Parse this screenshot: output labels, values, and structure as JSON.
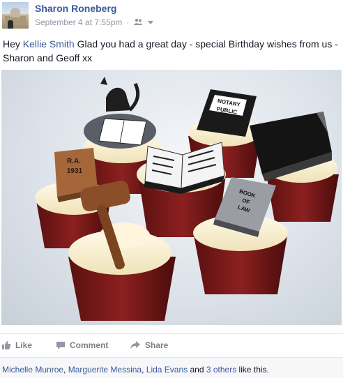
{
  "post": {
    "author": "Sharon Roneberg",
    "timestamp": "September 4 at 7:55pm",
    "separator": "·",
    "audience_icon": "friends-icon",
    "text_before": "Hey ",
    "mention": "Kellie Smith",
    "text_after": " Glad you had a great day - special Birthday wishes from us - Sharon and Geoff xx"
  },
  "photo": {
    "description_icon": "cupcakes-photo",
    "book_labels": {
      "notary_line1": "NOTARY",
      "notary_line2": "PUBLIC",
      "ra_line1": "R.A.",
      "ra_line2": "1931",
      "law_line1": "BOOK",
      "law_line2": "OF",
      "law_line3": "LAW"
    }
  },
  "actions": {
    "like_label": "Like",
    "comment_label": "Comment",
    "share_label": "Share"
  },
  "likes": {
    "people": [
      "Michelle Munroe",
      "Marguerite Messina",
      "Lida Evans"
    ],
    "comma": ", ",
    "and": " and ",
    "others": "3 others",
    "suffix": " like this."
  },
  "colors": {
    "link": "#3b5998",
    "meta": "#9197a3",
    "action": "#7f7f7f",
    "likes_bg": "#f6f7f9"
  }
}
